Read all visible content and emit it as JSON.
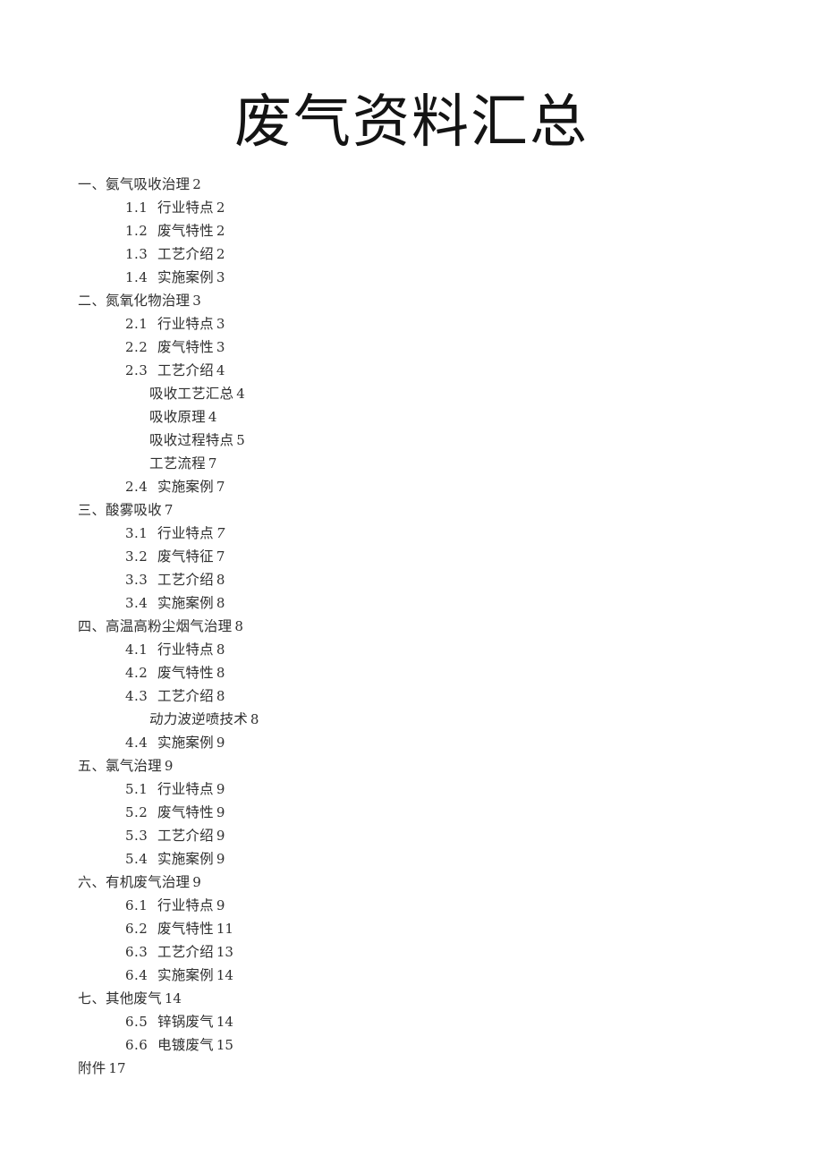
{
  "document": {
    "title": "废气资料汇总"
  },
  "toc": {
    "entries": [
      {
        "level": 1,
        "num": "一、",
        "label": "氨气吸收治理",
        "page": "2",
        "style": "normal"
      },
      {
        "level": 2,
        "num": "1.1",
        "label": "行业特点",
        "page": "2",
        "style": "normal"
      },
      {
        "level": 2,
        "num": "1.2",
        "label": "废气特性",
        "page": "2",
        "style": "normal"
      },
      {
        "level": 2,
        "num": "1.3",
        "label": "工艺介绍",
        "page": "2",
        "style": "normal"
      },
      {
        "level": 2,
        "num": "1.4",
        "label": "实施案例",
        "page": "3",
        "style": "normal"
      },
      {
        "level": 1,
        "num": "二、",
        "label": "氮氧化物治理",
        "page": "3",
        "style": "normal"
      },
      {
        "level": 2,
        "num": "2.1",
        "label": "行业特点",
        "page": "3",
        "style": "normal"
      },
      {
        "level": 2,
        "num": "2.2",
        "label": "废气特性",
        "page": "3",
        "style": "normal"
      },
      {
        "level": 2,
        "num": "2.3",
        "label": "工艺介绍",
        "page": "4",
        "style": "normal"
      },
      {
        "level": 3,
        "num": "",
        "label": "吸收工艺汇总",
        "page": "4",
        "style": "normal"
      },
      {
        "level": 3,
        "num": "",
        "label": "吸收原理",
        "page": "4",
        "style": "normal"
      },
      {
        "level": 3,
        "num": "",
        "label": "吸收过程特点",
        "page": "5",
        "style": "normal"
      },
      {
        "level": 3,
        "num": "",
        "label": "工艺流程",
        "page": "7",
        "style": "normal"
      },
      {
        "level": 2,
        "num": "2.4",
        "label": "实施案例",
        "page": "7",
        "style": "normal"
      },
      {
        "level": 1,
        "num": "三、",
        "label": "酸雾吸收",
        "page": "7",
        "style": "normal"
      },
      {
        "level": 2,
        "num": "3.1",
        "label": "行业特点",
        "page": "7",
        "style": "italic-page"
      },
      {
        "level": 2,
        "num": "3.2",
        "label": "废气特征",
        "page": "7",
        "style": "normal"
      },
      {
        "level": 2,
        "num": "3.3",
        "label": "工艺介绍",
        "page": "8",
        "style": "normal"
      },
      {
        "level": 2,
        "num": "3.4",
        "label": "实施案例",
        "page": "8",
        "style": "normal"
      },
      {
        "level": 1,
        "num": "四、",
        "label": "高温高粉尘烟气治理",
        "page": "8",
        "style": "normal"
      },
      {
        "level": 2,
        "num": "4.1",
        "label": "行业特点",
        "page": "8",
        "style": "normal"
      },
      {
        "level": 2,
        "num": "4.2",
        "label": "废气特性",
        "page": "8",
        "style": "normal"
      },
      {
        "level": 2,
        "num": "4.3",
        "label": "工艺介绍",
        "page": "8",
        "style": "normal"
      },
      {
        "level": 3,
        "num": "",
        "label": "动力波逆喷技术",
        "page": "8",
        "style": "kai"
      },
      {
        "level": 2,
        "num": "4.4",
        "label": "实施案例",
        "page": "9",
        "style": "normal"
      },
      {
        "level": 1,
        "num": "五、",
        "label": "氯气治理",
        "page": "9",
        "style": "normal"
      },
      {
        "level": 2,
        "num": "5.1",
        "label": "行业特点",
        "page": "9",
        "style": "normal"
      },
      {
        "level": 2,
        "num": "5.2",
        "label": "废气特性",
        "page": "9",
        "style": "normal"
      },
      {
        "level": 2,
        "num": "5.3",
        "label": "工艺介绍",
        "page": "9",
        "style": "normal"
      },
      {
        "level": 2,
        "num": "5.4",
        "label": "实施案例",
        "page": "9",
        "style": "normal"
      },
      {
        "level": 1,
        "num": "六、",
        "label": "有机废气治理",
        "page": "9",
        "style": "normal"
      },
      {
        "level": 2,
        "num": "6.1",
        "label": "行业特点",
        "page": "9",
        "style": "normal"
      },
      {
        "level": 2,
        "num": "6.2",
        "label": "废气特性",
        "page": "11",
        "style": "normal"
      },
      {
        "level": 2,
        "num": "6.3",
        "label": "工艺介绍",
        "page": "13",
        "style": "normal"
      },
      {
        "level": 2,
        "num": "6.4",
        "label": "实施案例",
        "page": "14",
        "style": "normal"
      },
      {
        "level": 1,
        "num": "七、",
        "label": "其他废气",
        "page": "14",
        "style": "normal"
      },
      {
        "level": 2,
        "num": "6.5",
        "label": "锌锅废气",
        "page": "14",
        "style": "normal"
      },
      {
        "level": 2,
        "num": "6.6",
        "label": "电镀废气",
        "page": "15",
        "style": "normal"
      },
      {
        "level": 1,
        "num": "",
        "label": "附件",
        "page": "17",
        "style": "normal"
      }
    ]
  },
  "colors": {
    "page_background": "#ffffff",
    "title_text": "#141414",
    "body_text": "#2f2f2f"
  }
}
